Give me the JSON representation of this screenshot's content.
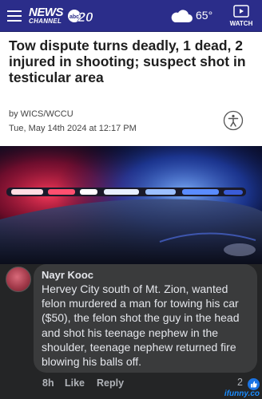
{
  "header": {
    "logo_news": "NEWS",
    "logo_channel": "CHANNEL",
    "logo_badge_number": "20",
    "temperature": "65°",
    "watch_label": "WATCH"
  },
  "article": {
    "headline": "Tow dispute turns deadly, 1 dead, 2 injured in shooting; suspect shot in testicular area",
    "byline": "by WICS/WCCU",
    "date": "Tue, May 14th 2024 at 12:17 PM"
  },
  "comment": {
    "author": "Nayr Kooc",
    "text": "Hervey City south of Mt. Zion, wanted felon murdered a man for towing his car ($50), the felon shot the guy in the head and shot his teenage nephew in the shoulder, teenage nephew returned fire blowing his balls off.",
    "time": "8h",
    "like_label": "Like",
    "reply_label": "Reply",
    "reaction_count": "2"
  },
  "watermark": "ifunny.co",
  "colors": {
    "header_bg": "#2b2d8a",
    "comment_bg": "#242526",
    "bubble_bg": "#3a3b3c",
    "like_blue": "#1b74e4"
  }
}
